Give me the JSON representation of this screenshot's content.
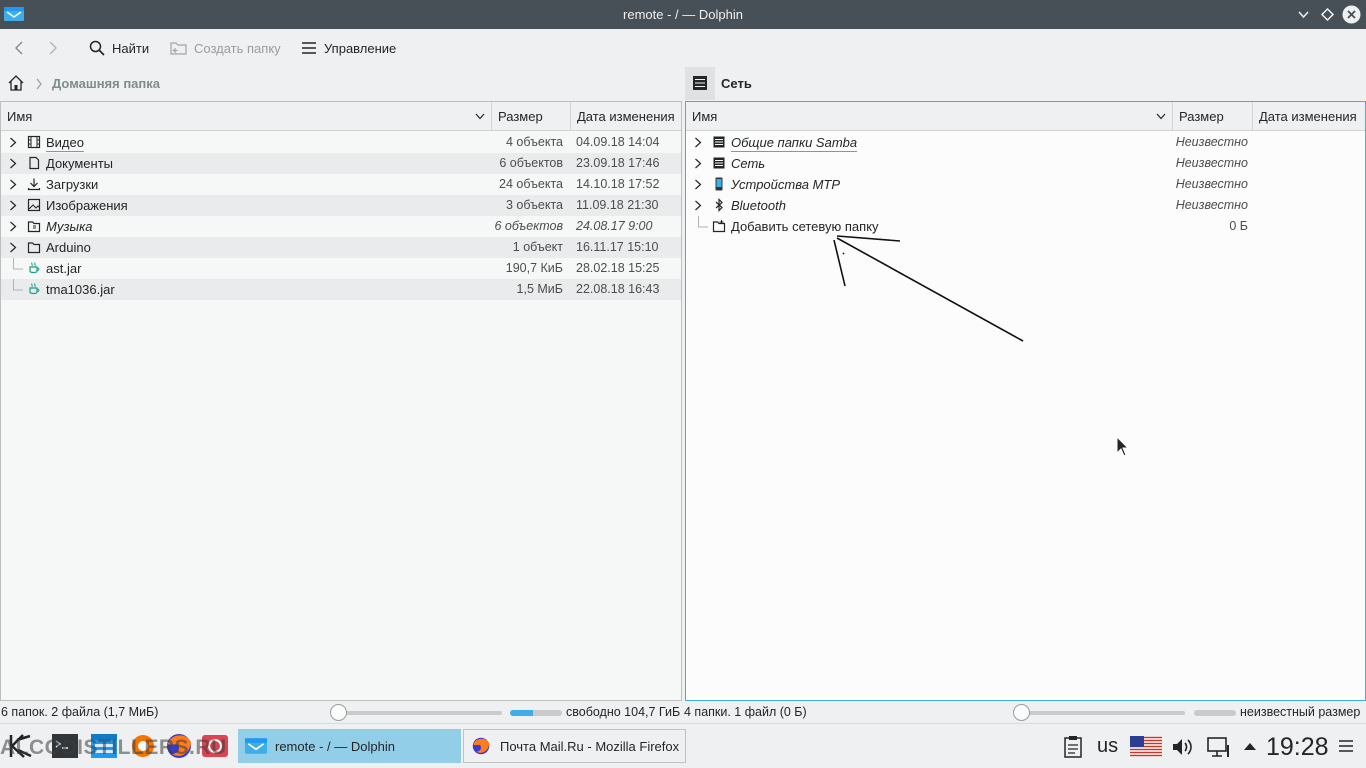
{
  "window": {
    "title": "remote - / — Dolphin"
  },
  "toolbar": {
    "find_label": "Найти",
    "create_folder_label": "Создать папку",
    "control_label": "Управление"
  },
  "left_pane": {
    "breadcrumb": "Домашняя папка",
    "columns": {
      "name": "Имя",
      "size": "Размер",
      "date": "Дата изменения"
    },
    "rows": [
      {
        "name": "Видео",
        "size": "4 объекта",
        "date": "04.09.18 14:04",
        "icon": "film-icon",
        "folder": true,
        "italic": false
      },
      {
        "name": "Документы",
        "size": "6 объектов",
        "date": "23.09.18 17:46",
        "icon": "document-icon",
        "folder": true,
        "italic": false
      },
      {
        "name": "Загрузки",
        "size": "24 объекта",
        "date": "14.10.18 17:52",
        "icon": "download-icon",
        "folder": true,
        "italic": false
      },
      {
        "name": "Изображения",
        "size": "3 объекта",
        "date": "11.09.18 21:30",
        "icon": "image-icon",
        "folder": true,
        "italic": false
      },
      {
        "name": "Музыка",
        "size": "6 объектов",
        "date": "24.08.17 9:00",
        "icon": "music-folder-icon",
        "folder": true,
        "italic": true
      },
      {
        "name": "Arduino",
        "size": "1 объект",
        "date": "16.11.17 15:10",
        "icon": "folder-icon",
        "folder": true,
        "italic": false
      },
      {
        "name": "ast.jar",
        "size": "190,7 КиБ",
        "date": "28.02.18 15:25",
        "icon": "java-icon",
        "folder": false,
        "italic": false
      },
      {
        "name": "tma1036.jar",
        "size": "1,5 МиБ",
        "date": "22.08.18 16:43",
        "icon": "java-icon",
        "folder": false,
        "italic": false
      }
    ],
    "status": "6 папок. 2 файла (1,7 МиБ)",
    "free_space": "свободно 104,7 ГиБ",
    "free_fraction": 0.45
  },
  "right_pane": {
    "breadcrumb": "Сеть",
    "columns": {
      "name": "Имя",
      "size": "Размер",
      "date": "Дата изменения"
    },
    "rows": [
      {
        "name": "Общие папки Samba",
        "size": "Неизвестно",
        "icon": "network-server-icon",
        "expandable": true,
        "italic": true
      },
      {
        "name": "Сеть",
        "size": "Неизвестно",
        "icon": "network-server-icon",
        "expandable": true,
        "italic": true
      },
      {
        "name": "Устройства MTP",
        "size": "Неизвестно",
        "icon": "phone-icon",
        "expandable": true,
        "italic": true
      },
      {
        "name": "Bluetooth",
        "size": "Неизвестно",
        "icon": "bluetooth-icon",
        "expandable": true,
        "italic": true
      },
      {
        "name": "Добавить сетевую папку",
        "size": "0 Б",
        "icon": "add-network-folder-icon",
        "expandable": false,
        "italic": false
      }
    ],
    "status": "4 папки. 1 файл (0 Б)",
    "size_text": "неизвестный размер"
  },
  "taskbar": {
    "tasks": [
      {
        "label": "remote - / — Dolphin",
        "active": true
      },
      {
        "label": "Почта Mail.Ru - Mozilla Firefox",
        "active": false
      }
    ],
    "keyboard_layout": "us",
    "clock": "19:28",
    "watermark": "ALCODISTILLERS.RU"
  },
  "colors": {
    "accent": "#3daee9",
    "titlebar": "#475057",
    "active_task": "#93cee9"
  }
}
